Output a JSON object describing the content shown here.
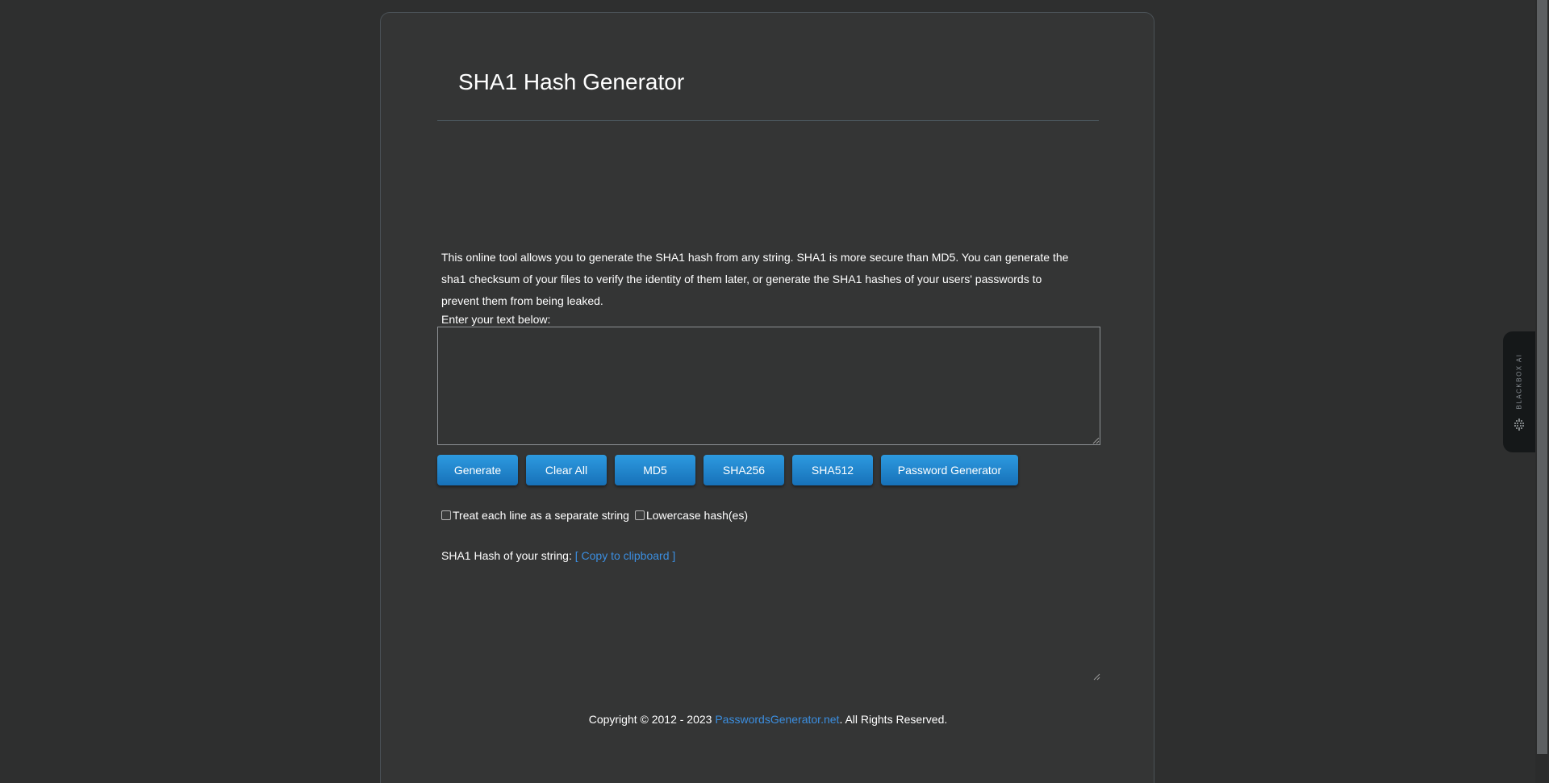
{
  "page": {
    "title": "SHA1 Hash Generator",
    "description": "This online tool allows you to generate the SHA1 hash from any string. SHA1 is more secure than MD5. You can generate the sha1 checksum of your files to verify the identity of them later, or generate the SHA1 hashes of your users' passwords to prevent them from being leaked.",
    "prompt": "Enter your text below:"
  },
  "input": {
    "value": "",
    "placeholder": ""
  },
  "buttons": {
    "generate": "Generate",
    "clear_all": "Clear All",
    "md5": "MD5",
    "sha256": "SHA256",
    "sha512": "SHA512",
    "password_generator": "Password Generator"
  },
  "options": {
    "separate_lines_label": "Treat each line as a separate string",
    "separate_lines_checked": false,
    "lowercase_label": "Lowercase hash(es)",
    "lowercase_checked": false
  },
  "result": {
    "label": "SHA1 Hash of your string:",
    "copy_link": "[ Copy to clipboard ]",
    "value": ""
  },
  "footer": {
    "prefix": "Copyright © 2012 - 2023 ",
    "link": "PasswordsGenerator.net",
    "suffix": ". All Rights Reserved."
  },
  "side_tab": {
    "label": "BLACKBOX AI"
  },
  "colors": {
    "background": "#2e2f2f",
    "card": "#343535",
    "button": "#1e83cc",
    "link": "#3b8ee0"
  }
}
